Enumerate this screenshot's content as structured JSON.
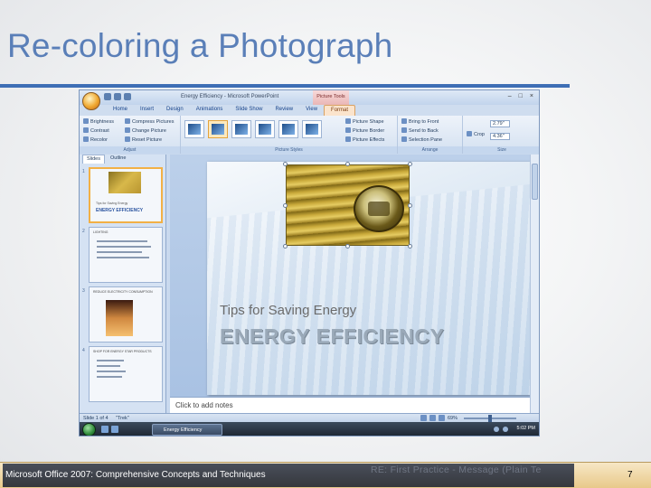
{
  "slide": {
    "title": "Re-coloring a Photograph",
    "footer": "Microsoft Office 2007: Comprehensive Concepts and Techniques",
    "footer_ghost": "RE: First Practice - Message (Plain Te",
    "page_number": "7"
  },
  "window": {
    "title": "Energy Efficiency - Microsoft PowerPoint",
    "context_tab_header": "Picture Tools",
    "tabs": [
      "Home",
      "Insert",
      "Design",
      "Animations",
      "Slide Show",
      "Review",
      "View",
      "Format"
    ],
    "active_tab": "Format"
  },
  "ribbon": {
    "adjust": {
      "label": "Adjust",
      "brightness": "Brightness",
      "contrast": "Contrast",
      "recolor": "Recolor",
      "compress": "Compress Pictures",
      "change": "Change Picture",
      "reset": "Reset Picture"
    },
    "styles": {
      "label": "Picture Styles",
      "shape": "Picture Shape",
      "border": "Picture Border",
      "effects": "Picture Effects"
    },
    "arrange": {
      "label": "Arrange",
      "front": "Bring to Front",
      "back": "Send to Back",
      "pane": "Selection Pane"
    },
    "size": {
      "label": "Size",
      "crop": "Crop",
      "height": "2.79\"",
      "width": "4.36\""
    }
  },
  "pane": {
    "tab_slides": "Slides",
    "tab_outline": "Outline",
    "thumbs": [
      {
        "num": "1",
        "t1": "Tips for Saving Energy",
        "t2": "ENERGY EFFICIENCY"
      },
      {
        "num": "2",
        "hdr": "LIGHTING"
      },
      {
        "num": "3",
        "hdr": "REDUCE ELECTRICITY CONSUMPTION"
      },
      {
        "num": "4",
        "hdr": "SHOP FOR ENERGY STAR PRODUCTS"
      }
    ]
  },
  "main_slide": {
    "subtitle": "Tips for Saving Energy",
    "title": "ENERGY EFFICIENCY",
    "notes_placeholder": "Click to add notes"
  },
  "status": {
    "slide_of": "Slide 1 of 4",
    "theme": "\"Trek\"",
    "zoom": "69%"
  },
  "taskbar": {
    "task": "Energy Efficiency",
    "clock": "5:02 PM"
  },
  "colors": {
    "title": "#5a7fb8",
    "rule": "#3e6eb5",
    "selection_border": "#f2b045"
  }
}
